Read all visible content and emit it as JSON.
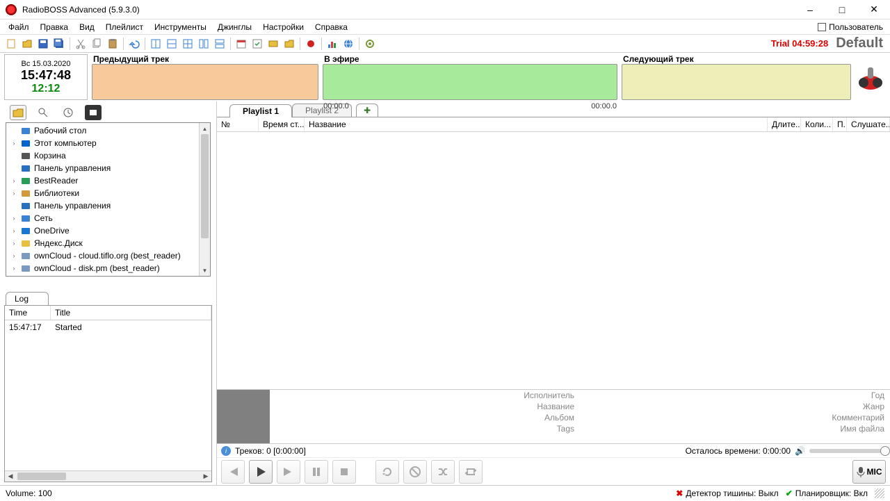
{
  "window": {
    "title": "RadioBOSS Advanced (5.9.3.0)"
  },
  "menu": {
    "items": [
      "Файл",
      "Правка",
      "Вид",
      "Плейлист",
      "Инструменты",
      "Джинглы",
      "Настройки",
      "Справка"
    ],
    "user": "Пользователь"
  },
  "toolbar": {
    "trial": "Trial 04:59:28",
    "profile": "Default"
  },
  "clock": {
    "date": "Вс 15.03.2020",
    "time": "15:47:48",
    "duration": "12:12"
  },
  "tracks": {
    "prev_label": "Предыдущий трек",
    "onair_label": "В эфире",
    "next_label": "Следующий трек",
    "onair_start": "00:00.0",
    "onair_end": "00:00.0"
  },
  "tree": {
    "items": [
      {
        "expand": "",
        "icon": "monitor",
        "label": "Рабочий стол",
        "color": "#3a82d4"
      },
      {
        "expand": "›",
        "icon": "pc",
        "label": "Этот компьютер",
        "color": "#0066cc"
      },
      {
        "expand": "",
        "icon": "bin",
        "label": "Корзина",
        "color": "#555"
      },
      {
        "expand": "",
        "icon": "panel",
        "label": "Панель управления",
        "color": "#2a70c0"
      },
      {
        "expand": "›",
        "icon": "user",
        "label": "BestReader",
        "color": "#2a9c5a"
      },
      {
        "expand": "›",
        "icon": "lib",
        "label": "Библиотеки",
        "color": "#d49a3a"
      },
      {
        "expand": "",
        "icon": "panel",
        "label": "Панель управления",
        "color": "#2a70c0"
      },
      {
        "expand": "›",
        "icon": "net",
        "label": "Сеть",
        "color": "#3a82d4"
      },
      {
        "expand": "›",
        "icon": "cloud",
        "label": "OneDrive",
        "color": "#1976d2"
      },
      {
        "expand": "›",
        "icon": "folder",
        "label": "Яндекс.Диск",
        "color": "#e8c040"
      },
      {
        "expand": "›",
        "icon": "cloud2",
        "label": "ownCloud - cloud.tiflo.org (best_reader)",
        "color": "#7a9ac0"
      },
      {
        "expand": "›",
        "icon": "cloud2",
        "label": "ownCloud - disk.pm (best_reader)",
        "color": "#7a9ac0"
      }
    ]
  },
  "log": {
    "tab": "Log",
    "head_time": "Time",
    "head_title": "Title",
    "rows": [
      {
        "time": "15:47:17",
        "title": "Started"
      }
    ]
  },
  "playlist": {
    "tabs": [
      "Playlist 1",
      "Playlist 2"
    ],
    "active": 0,
    "columns": {
      "num": "№",
      "start": "Время ст...",
      "name": "Название",
      "dur": "Длите...",
      "cnt": "Коли...",
      "p": "П.",
      "lst": "Слушате..."
    }
  },
  "info": {
    "left": [
      "Исполнитель",
      "Название",
      "Альбом",
      "Tags"
    ],
    "right": [
      "Год",
      "Жанр",
      "Комментарий",
      "Имя файла"
    ]
  },
  "status": {
    "tracks": "Треков: 0 [0:00:00]",
    "remaining": "Осталось времени: 0:00:00"
  },
  "bottom": {
    "volume": "Volume: 100",
    "silence": "Детектор тишины: Выкл",
    "scheduler": "Планировщик: Вкл"
  },
  "mic": "MIC"
}
